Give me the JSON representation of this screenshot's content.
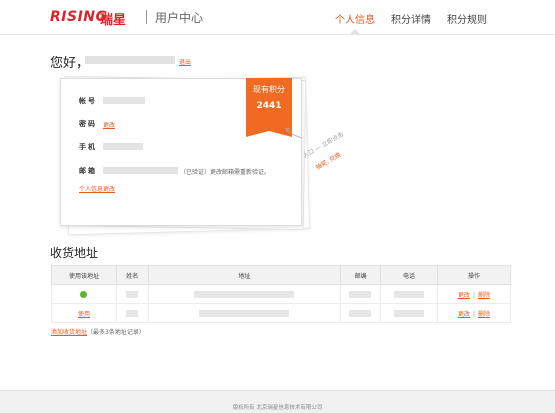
{
  "header": {
    "logo_en": "RISING",
    "logo_cn": "瑞星",
    "subtitle": "用户中心",
    "nav": [
      "个人信息",
      "积分详情",
      "积分规则"
    ]
  },
  "greeting": {
    "hello": "您好，",
    "logout": "退出"
  },
  "profile": {
    "account_label": "帐号",
    "password_label": "密码",
    "password_change": "更改",
    "phone_label": "手机",
    "email_label": "邮箱",
    "email_note": "（已验证）更改邮箱需重新验证。",
    "edit_info": "个人信息更改"
  },
  "points": {
    "title": "现有积分",
    "value": "2441",
    "hint_line1": "入口 — 立即点击",
    "hint_line2": "抽奖, 兑换"
  },
  "address": {
    "section_title": "收货地址",
    "columns": [
      "使用该地址",
      "姓名",
      "地址",
      "邮编",
      "电话",
      "操作"
    ],
    "rows": [
      {
        "use": "",
        "actions": [
          "更改",
          "删除"
        ]
      },
      {
        "use": "使用",
        "actions": [
          "更改",
          "删除"
        ]
      }
    ],
    "add_link": "添加收货地址",
    "add_note": "（最多3条地址记录）"
  },
  "footer": {
    "text": "版权所有 北京瑞星信息技术有限公司"
  },
  "colors": {
    "brand_red": "#d8262c",
    "accent_orange": "#e35d20",
    "ribbon": "#f06a22",
    "check_green": "#5cb531"
  }
}
